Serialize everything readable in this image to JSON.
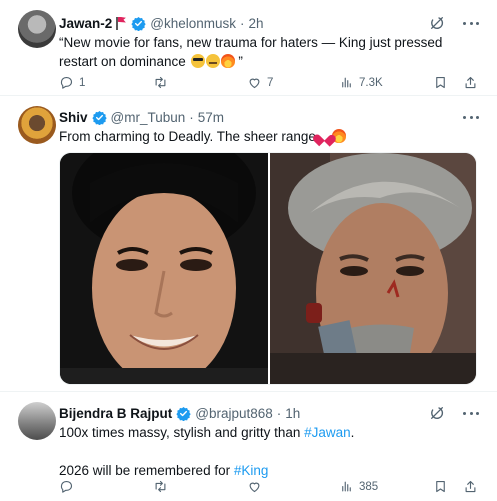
{
  "tweets": [
    {
      "name": "Jawan-2",
      "handle": "@khelonmusk",
      "time": "2h",
      "text": "“New movie for fans, new trauma for haters — King just pressed restart on dominance",
      "text_end": " ”",
      "emojis": [
        "smiling-face-with-sunglasses",
        "saluting-face",
        "fire"
      ],
      "stats": {
        "replies": "1",
        "retweets": "",
        "likes": "7",
        "views": "7.3K"
      }
    },
    {
      "name": "Shiv",
      "handle": "@mr_Tubun",
      "time": "57m",
      "text": "From charming to Deadly. The sheer range",
      "emojis": [
        "red-heart",
        "fire"
      ],
      "media": [
        "portrait-smiling",
        "portrait-grey-hair"
      ]
    },
    {
      "name": "Bijendra B Rajput",
      "handle": "@brajput868",
      "time": "1h",
      "line1_text": "100x times massy, stylish and gritty than ",
      "line1_tag": "#Jawan",
      "line1_end": ".",
      "line2_text": "2026 will be remembered for ",
      "line2_tag": "#King",
      "stats": {
        "replies": "",
        "retweets": "",
        "likes": "",
        "views": "385"
      }
    }
  ],
  "separator": "·",
  "colors": {
    "verified": "#1d9bf0",
    "secondary_text": "#536471",
    "hashtag": "#1d9bf0",
    "flag": "#e0245e"
  },
  "icons": [
    "reply-icon",
    "retweet-icon",
    "like-icon",
    "views-icon",
    "bookmark-icon",
    "share-icon",
    "grok-icon",
    "more-icon",
    "verified-badge-icon",
    "flag-icon"
  ]
}
